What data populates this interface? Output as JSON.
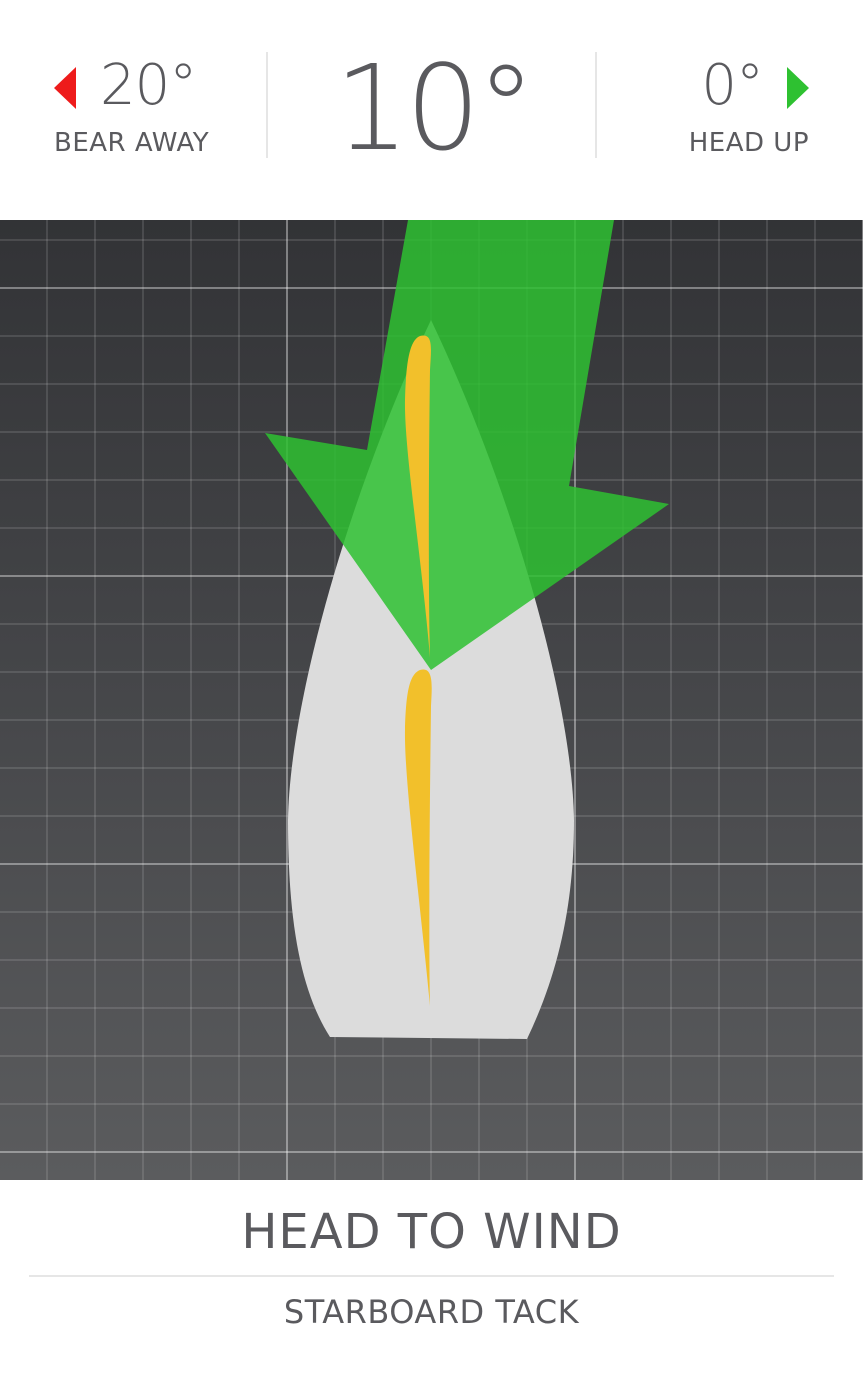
{
  "header": {
    "bear_away": {
      "value": "20°",
      "label": "BEAR AWAY",
      "icon": "left-triangle-icon",
      "color": "#ee1b1b"
    },
    "heading_offset": "10°",
    "head_up": {
      "value": "0°",
      "label": "HEAD UP",
      "icon": "right-triangle-icon",
      "color": "#2ec131"
    }
  },
  "footer": {
    "status": "HEAD TO WIND",
    "tack": "STARBOARD TACK"
  },
  "colors": {
    "wind_arrow": "#2ec131",
    "hull": "#dcdcdc",
    "sails": "#f2c02b",
    "background_top": "#323336",
    "background_bottom": "#5b5c5e"
  }
}
